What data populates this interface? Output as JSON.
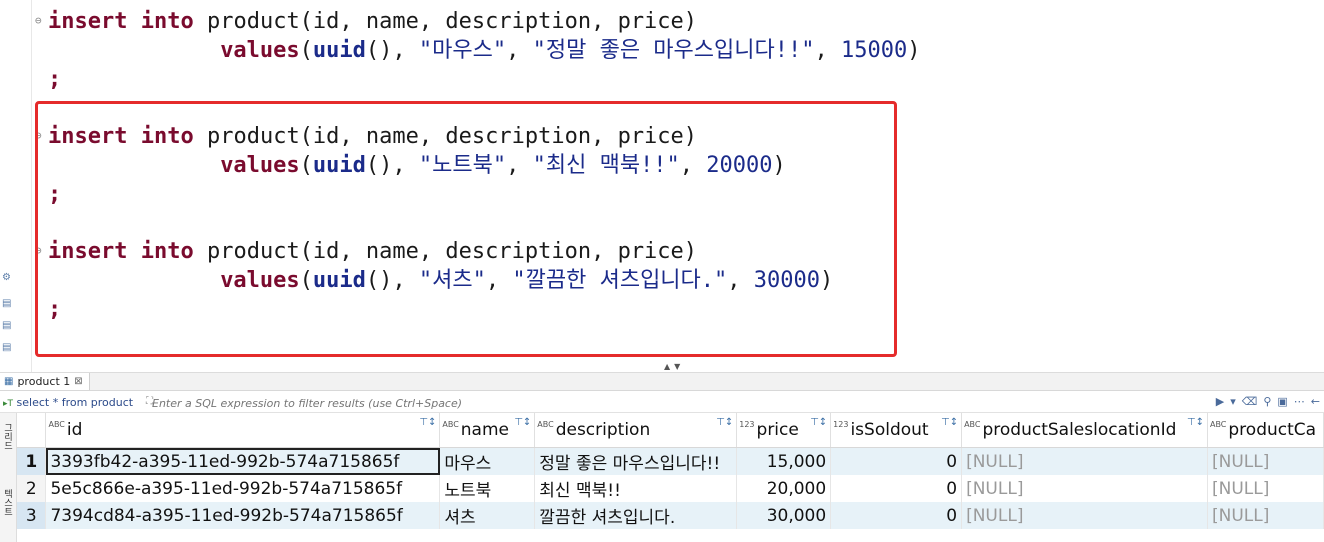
{
  "editor": {
    "statements": [
      {
        "kw1": "insert",
        "kw2": "into",
        "table_cols": "product(id, name, description, price)",
        "values_kw": "values",
        "fn": "uuid",
        "name": "\"마우스\"",
        "desc": "\"정말 좋은 마우스입니다!!\"",
        "price": "15000",
        "semi": ";"
      },
      {
        "kw1": "insert",
        "kw2": "into",
        "table_cols": "product(id, name, description, price)",
        "values_kw": "values",
        "fn": "uuid",
        "name": "\"노트북\"",
        "desc": "\"최신 맥북!!\"",
        "price": "20000",
        "semi": ";"
      },
      {
        "kw1": "insert",
        "kw2": "into",
        "table_cols": "product(id, name, description, price)",
        "values_kw": "values",
        "fn": "uuid",
        "name": "\"셔츠\"",
        "desc": "\"깔끔한 셔츠입니다.\"",
        "price": "30000",
        "semi": ";"
      }
    ],
    "highlight_color": "#e52b2b"
  },
  "results": {
    "tab_label": "product 1",
    "query_label": "select * from product",
    "filter_placeholder": "Enter a SQL expression to filter results (use Ctrl+Space)",
    "side_tabs": [
      "그리드",
      "텍스트"
    ],
    "columns": [
      {
        "type": "ABC",
        "label": "id"
      },
      {
        "type": "ABC",
        "label": "name"
      },
      {
        "type": "ABC",
        "label": "description"
      },
      {
        "type": "123",
        "label": "price"
      },
      {
        "type": "123",
        "label": "isSoldout"
      },
      {
        "type": "ABC",
        "label": "productSaleslocationId"
      },
      {
        "type": "ABC",
        "label": "productCa"
      }
    ],
    "rows": [
      {
        "num": "1",
        "id": "3393fb42-a395-11ed-992b-574a715865f",
        "name": "마우스",
        "description": "정말 좋은 마우스입니다!!",
        "price": "15,000",
        "isSoldout": "0",
        "loc": "[NULL]",
        "cat": "[NULL]"
      },
      {
        "num": "2",
        "id": "5e5c866e-a395-11ed-992b-574a715865f",
        "name": "노트북",
        "description": "최신 맥북!!",
        "price": "20,000",
        "isSoldout": "0",
        "loc": "[NULL]",
        "cat": "[NULL]"
      },
      {
        "num": "3",
        "id": "7394cd84-a395-11ed-992b-574a715865f",
        "name": "셔츠",
        "description": "깔끔한 셔츠입니다.",
        "price": "30,000",
        "isSoldout": "0",
        "loc": "[NULL]",
        "cat": "[NULL]"
      }
    ]
  }
}
